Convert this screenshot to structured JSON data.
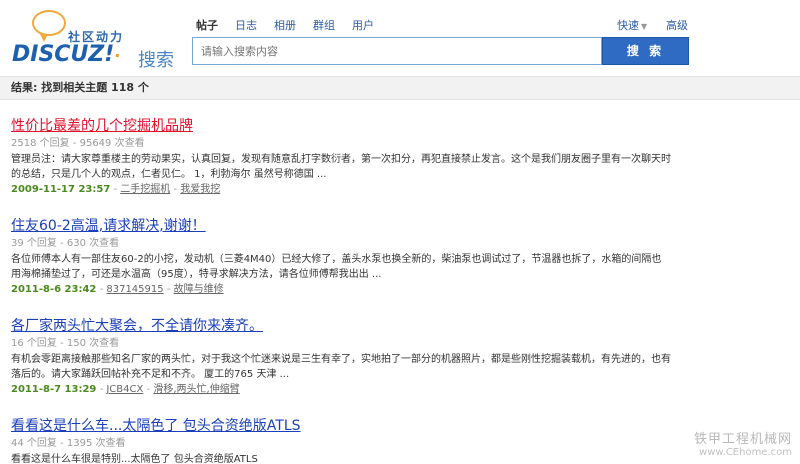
{
  "header": {
    "logo_slogan": "社区动力",
    "logo_brand": "DISCUZ!",
    "logo_dot": "·",
    "logo_search_word": "搜索",
    "tabs": [
      {
        "label": "帖子",
        "active": true
      },
      {
        "label": "日志",
        "active": false
      },
      {
        "label": "相册",
        "active": false
      },
      {
        "label": "群组",
        "active": false
      },
      {
        "label": "用户",
        "active": false
      }
    ],
    "quick_label": "快速",
    "advanced_label": "高级",
    "search_placeholder": "请输入搜索内容",
    "search_button": "搜 索"
  },
  "result_summary": "结果: 找到相关主题 118 个",
  "results": [
    {
      "title": "性价比最差的几个挖掘机品牌",
      "hot": true,
      "meta": "2518 个回复 - 95649 次查看",
      "snippet": "管理员注：请大家尊重楼主的劳动果实，认真回复，发现有随意乱打字数衍者，第一次扣分，再犯直接禁止发言。这个是我们朋友圈子里有一次聊天时的总结，只是几个人的观点，仁者见仁。 1，利勃海尔 虽然号称德国 ...",
      "date": "2009-11-17 23:57",
      "author": "二手挖掘机",
      "forum": "我爱我挖"
    },
    {
      "title": "住友60-2高温,请求解决,谢谢！",
      "hot": false,
      "meta": "39 个回复 - 630 次查看",
      "snippet": "各位师傅本人有一部住友60-2的小挖，发动机（三菱4M40）已经大修了，盖头水泵也换全新的，柴油泵也调试过了，节温器也拆了，水箱的间隔也用海棉捅垫过了，可还是水温高（95度），特寻求解决方法，请各位师傅帮我出出 ...",
      "date": "2011-8-6 23:42",
      "author": "837145915",
      "forum": "故障与维修"
    },
    {
      "title": "各厂家两头忙大聚会，不全请你来凑齐。",
      "hot": false,
      "meta": "16 个回复 - 150 次查看",
      "snippet": "有机会零距离接触那些知名厂家的两头忙，对于我这个忙迷来说是三生有幸了，实地拍了一部分的机器照片，都是些刚性挖掘装载机，有先进的，也有落后的。请大家踊跃回帖补充不足和不齐。 厦工的765 天津 ...",
      "date": "2011-8-7 13:29",
      "author": "JCB4CX",
      "forum": "滑移,两头忙,伸缩臂"
    },
    {
      "title": "看看这是什么车...太隔色了 包头合资绝版ATLS",
      "hot": false,
      "meta": "44 个回复 - 1395 次查看",
      "snippet": "看看这是什么车很是特别...太隔色了 包头合资绝版ATLS",
      "date": "",
      "author": "",
      "forum": ""
    }
  ],
  "watermark": {
    "line1": "铁甲工程机械网",
    "line2": "www.CEhome.com"
  }
}
